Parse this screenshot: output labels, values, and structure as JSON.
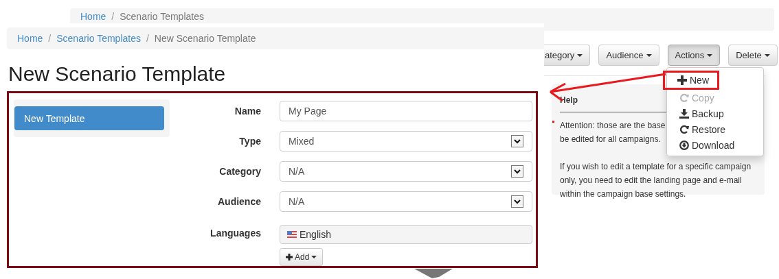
{
  "background_page": {
    "breadcrumb": [
      {
        "label": "Home",
        "active": false
      },
      {
        "label": "Scenario Templates",
        "active": true,
        "separator": "/"
      }
    ],
    "toolbar": [
      {
        "label": "ategory",
        "active": false
      },
      {
        "label": "Audience",
        "active": false
      },
      {
        "label": "Actions",
        "active": true
      },
      {
        "label": "Delete",
        "active": false
      }
    ],
    "actions_menu": [
      {
        "label": "New",
        "kind": "new",
        "disabled": false,
        "annotated": true
      },
      {
        "label": "Copy",
        "kind": "copy",
        "disabled": true,
        "annotated": false
      },
      {
        "label": "Backup",
        "kind": "backup",
        "disabled": false,
        "annotated": false
      },
      {
        "label": "Restore",
        "kind": "restore",
        "disabled": false,
        "annotated": false
      },
      {
        "label": "Download",
        "kind": "download",
        "disabled": false,
        "annotated": false
      }
    ],
    "help": {
      "title": "Help",
      "lines": [
        "Attention: those are the base",
        "be edited for all campaigns."
      ],
      "paragraph": "If you wish to edit a template for a specific campaign only, you need to edit the landing page and e-mail within the campaign base settings."
    }
  },
  "dialog": {
    "breadcrumb": [
      {
        "label": "Home",
        "active": false
      },
      {
        "label": "Scenario Templates",
        "active": false,
        "separator": "/"
      },
      {
        "label": "New Scenario Template",
        "active": true,
        "separator": "/"
      }
    ],
    "title": "New Scenario Template",
    "sidebar": {
      "items": [
        {
          "label": "New Template",
          "selected": true
        }
      ]
    },
    "form": [
      {
        "label": "Name",
        "kind": "text",
        "value": "My Page"
      },
      {
        "label": "Type",
        "kind": "select",
        "value": "Mixed"
      },
      {
        "label": "Category",
        "kind": "select",
        "value": "N/A"
      },
      {
        "label": "Audience",
        "kind": "select",
        "value": "N/A"
      },
      {
        "label": "Languages",
        "kind": "languages",
        "items": [
          {
            "label": "English"
          }
        ],
        "add_button": "Add"
      }
    ]
  }
}
